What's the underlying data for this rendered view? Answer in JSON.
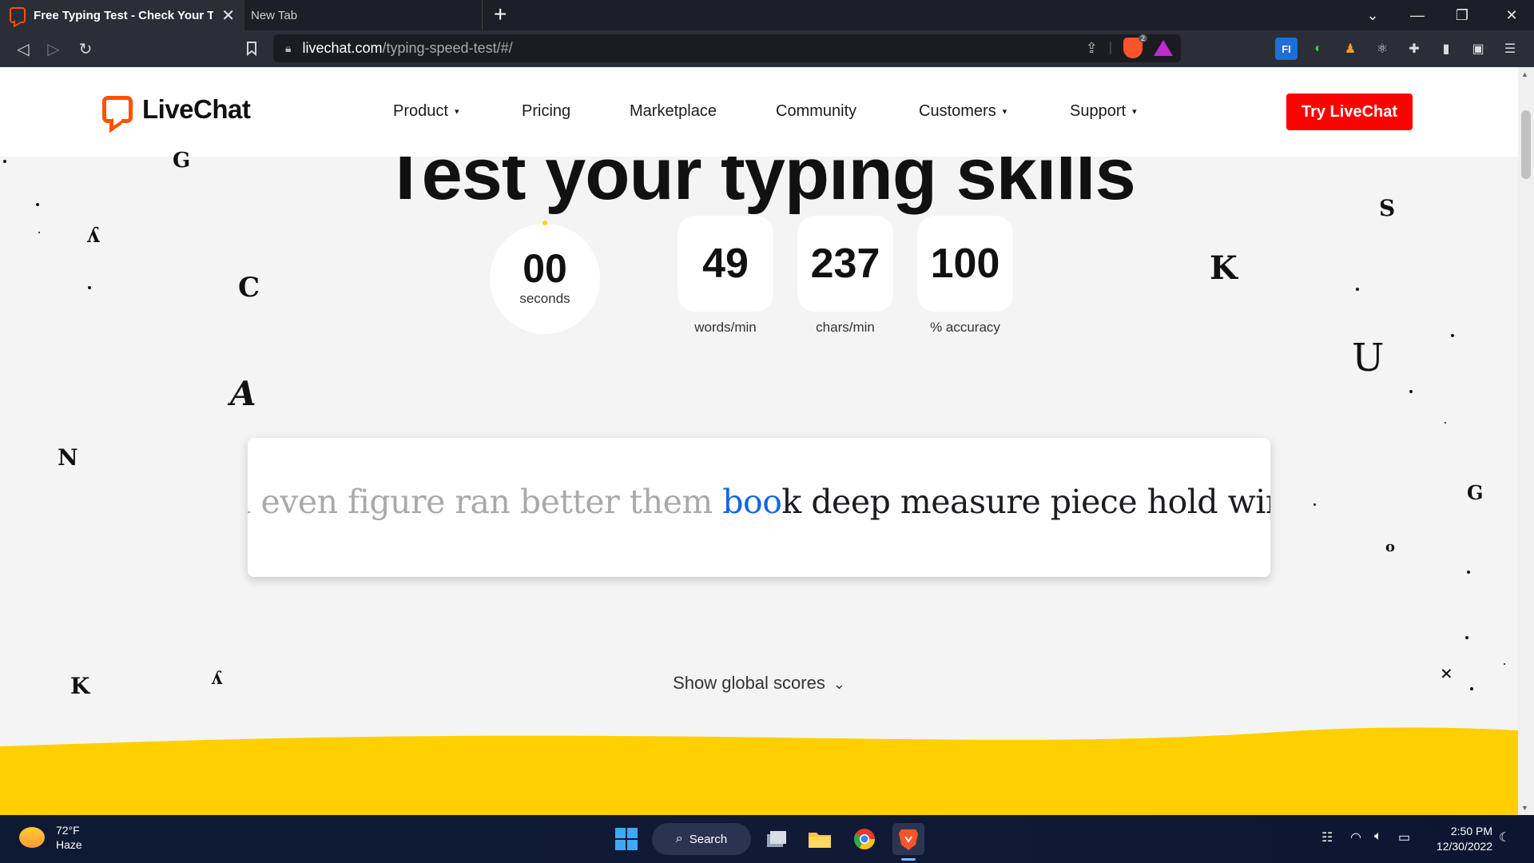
{
  "browser": {
    "tabs": [
      {
        "title": "Free Typing Test - Check Your Typ",
        "active": true
      },
      {
        "title": "New Tab",
        "active": false
      }
    ],
    "url_host": "livechat.com",
    "url_path": "/typing-speed-test/#/",
    "shield_count": "2"
  },
  "site": {
    "logo": "LiveChat",
    "nav": [
      "Product",
      "Pricing",
      "Marketplace",
      "Community",
      "Customers",
      "Support"
    ],
    "nav_caret": "▾",
    "cta": "Try LiveChat",
    "hero_title": "Test your typing skills",
    "timer": {
      "value": "00",
      "unit": "seconds"
    },
    "stats": [
      {
        "value": "49",
        "label": "words/min"
      },
      {
        "value": "237",
        "label": "chars/min"
      },
      {
        "value": "100",
        "label": "% accuracy"
      }
    ],
    "typing": {
      "typed": "n even figure ran better them ",
      "active_typed": "boo",
      "active_rest": "k",
      "upcoming": " deep measure piece hold wind f"
    },
    "show_scores": "Show global scores",
    "accent_color": "#ff5100",
    "cta_color": "#ff0000",
    "wave_color": "#ffd000",
    "highlight_color": "#0e68e6"
  },
  "taskbar": {
    "weather_temp": "72°F",
    "weather_desc": "Haze",
    "search_label": "Search",
    "time": "2:50 PM",
    "date": "12/30/2022"
  }
}
